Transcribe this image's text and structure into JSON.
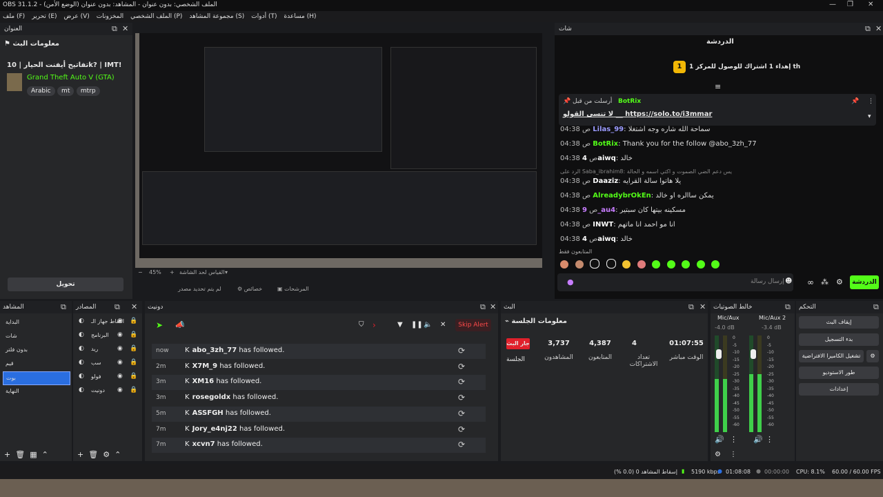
{
  "window": {
    "title": "OBS 31.1.2 - الملف الشخصي: بدون عنوان - المشاهد: بدون عنوان (الوضع الأمن)"
  },
  "menu": [
    "ملف (F)",
    "تحرير (E)",
    "عرض (V)",
    "المخزونات",
    "الملف الشخصي (P)",
    "مجموعة المشاهد (S)",
    "أدوات (T)",
    "مساعدة (H)"
  ],
  "info_dock": {
    "header": "العنوان",
    "title": "معلومات البث",
    "stream_title": "تفاتيح أيفنت الحيار | 10k? | IMT!",
    "game": "Grand Theft Auto V (GTA)",
    "tags": [
      "Arabic",
      "mt",
      "mtrp"
    ],
    "edit_button": "تحويل"
  },
  "preview_bar": {
    "zoom": "45%",
    "zoom_label": "القياس لحد الشاشة",
    "no_source": "لم يتم تحديد مصدر",
    "filters": "خصائص",
    "transitions": "المرشحات"
  },
  "chat_dock": {
    "header": "شات",
    "title": "الدردشة",
    "gift_text": "إهداء 1 اشتراك للوصول للمركز 1 th",
    "pinned_by": "أرسلت من قبل",
    "pinned_user": "BotRix",
    "pinned_text": "لا تنسى القولو __ https://solo.to/i3mmar",
    "send_placeholder": "إرسال رسالة",
    "chat_button": "الدردشة",
    "followers_only": "المتابعون فقط"
  },
  "chat_messages": [
    {
      "time": "04:38 ص",
      "user": "Lilas_99",
      "text": "سماحة الله شاره وجه اشتغلا",
      "color": "#9b9bff"
    },
    {
      "time": "04:38 ص",
      "user": "BotRix",
      "text": "Thank you for the follow @abo_3zh_77",
      "color": "#53fc18"
    },
    {
      "time": "04:38 ص",
      "user": "4aiwq",
      "text": "خالد",
      "color": "#ffffff"
    },
    {
      "time": "04:38 ص",
      "user": "Daaziz",
      "text": "يلا هاتوا سالة القرايه",
      "color": "#ffffff",
      "reply": "الرد على Saba_ibrahim8: يس دعم الضي الصموت و اكتي اسمه و الحالة"
    },
    {
      "time": "04:38 ص",
      "user": "AlreadybrOkEn",
      "text": "يمكن ساالره او خالد",
      "color": "#53fc18"
    },
    {
      "time": "04:38 ص",
      "user": "9_au4",
      "text": "مسكينه بيتها كان سبتير",
      "color": "#c77dff"
    },
    {
      "time": "04:38 ص",
      "user": "INWT",
      "text": "انا مو احمد انا ماتهم",
      "color": "#ffffff"
    },
    {
      "time": "04:38 ص",
      "user": "4aiwq",
      "text": "خالد",
      "color": "#ffffff"
    }
  ],
  "scenes": {
    "header": "المشاهد",
    "items": [
      "البداية",
      "شات",
      "بدون فلتر",
      "قيم",
      "بوت",
      "النهاية"
    ],
    "selected": 4
  },
  "sources": {
    "header": "المصادر",
    "items": [
      "التقاط جهاز الـ",
      "البرنامج",
      "ريد",
      "سب",
      "فولو",
      "دونيت"
    ]
  },
  "donate_dock": {
    "header": "دونيت",
    "skip_alert": "Skip Alert"
  },
  "donate_rows": [
    {
      "time": "now",
      "user": "abo_3zh_77",
      "text": "has followed."
    },
    {
      "time": "2m",
      "user": "X7M_9",
      "text": "has followed."
    },
    {
      "time": "3m",
      "user": "XM16",
      "text": "has followed."
    },
    {
      "time": "3m",
      "user": "rosegoldx",
      "text": "has followed."
    },
    {
      "time": "5m",
      "user": "ASSFGH",
      "text": "has followed."
    },
    {
      "time": "7m",
      "user": "Jory_e4nj22",
      "text": "has followed."
    },
    {
      "time": "7m",
      "user": "xcvn7",
      "text": "has followed."
    }
  ],
  "stream_dock": {
    "header": "البث",
    "title": "معلومات الجلسة",
    "live_badge": "جار البث",
    "session": "الجلسة",
    "stats": [
      {
        "value": "3,737",
        "label": "المشاهدون"
      },
      {
        "value": "4,387",
        "label": "المتابعون"
      },
      {
        "value": "4",
        "label": "تعداد الاشتراكات"
      },
      {
        "value": "01:07:55",
        "label": "الوقت مباشر"
      }
    ]
  },
  "mixer": {
    "header": "خالط الصوتيات",
    "channels": [
      {
        "name": "Mic/Aux",
        "db": "-4.0 dB",
        "level": 0.55
      },
      {
        "name": "Mic/Aux 2",
        "db": "-3.4 dB",
        "level": 0.6
      }
    ],
    "ticks": [
      "0",
      "-5",
      "-10",
      "-15",
      "-20",
      "-25",
      "-30",
      "-35",
      "-40",
      "-45",
      "-50",
      "-55",
      "-60"
    ]
  },
  "controls": {
    "header": "التحكم",
    "buttons": [
      "إيقاف البث",
      "بدء التسجيل",
      "تشغيل الكاميرا الافتراضية",
      "طور الاستوديو",
      "إعدادات"
    ]
  },
  "statusbar": {
    "dropped": "إسقاط المشاهد 0 (0.0 %)",
    "bitrate": "5190 kbps",
    "live_time": "01:08:08",
    "rec_time": "00:00:00",
    "cpu": "CPU: 8.1%",
    "fps": "60.00 / 60.00 FPS"
  },
  "colors": {
    "accent": "#2a6ee0",
    "kick_green": "#53fc18",
    "live_red": "#e0202b"
  }
}
